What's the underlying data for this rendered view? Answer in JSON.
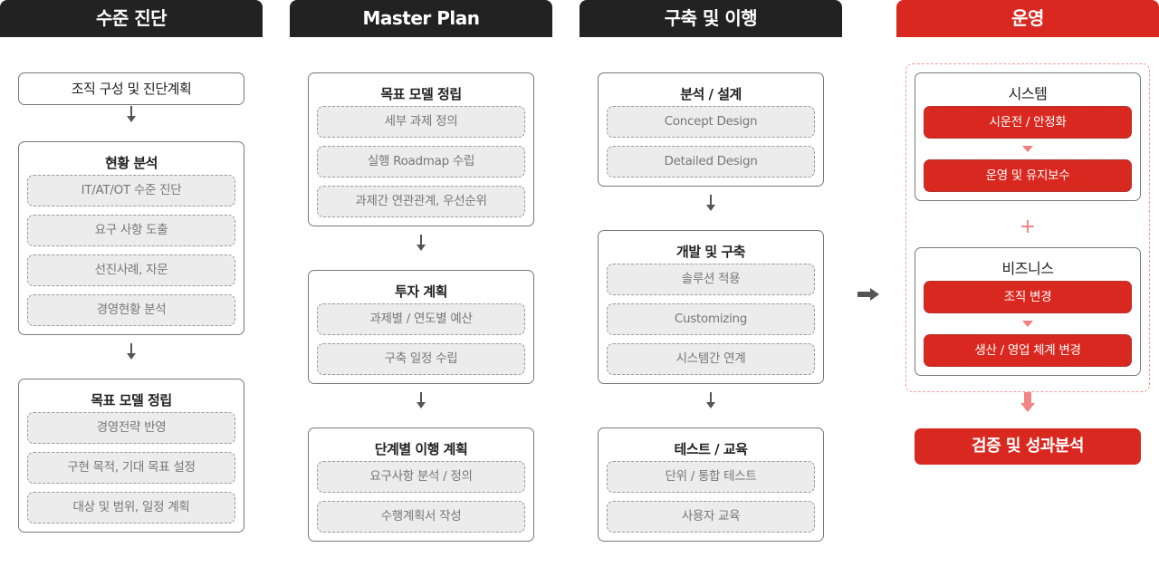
{
  "columns": [
    {
      "title": "수준 진단",
      "boxes": [
        {
          "title": "조직 구성 및 진단계획",
          "items": []
        },
        {
          "title": "현황 분석",
          "items": [
            "IT/AT/OT 수준 진단",
            "요구 사항 도출",
            "선진사례, 자문",
            "경영현황 분석"
          ]
        },
        {
          "title": "목표 모델 정립",
          "items": [
            "경영전략 반영",
            "구현 목적, 기대 목표 설정",
            "대상 및 범위, 일정 계획"
          ]
        }
      ]
    },
    {
      "title": "Master Plan",
      "boxes": [
        {
          "title": "목표 모델 정립",
          "items": [
            "세부 과제 정의",
            "실행 Roadmap 수립",
            "과제간 연관관계, 우선순위"
          ]
        },
        {
          "title": "투자 계획",
          "items": [
            "과제별 / 연도별 예산",
            "구축 일정 수립"
          ]
        },
        {
          "title": "단계별 이행 계획",
          "items": [
            "요구사항 분석 / 정의",
            "수행계획서 작성"
          ]
        }
      ]
    },
    {
      "title": "구축 및 이행",
      "boxes": [
        {
          "title": "분석 / 설계",
          "items": [
            "Concept Design",
            "Detailed Design"
          ]
        },
        {
          "title": "개발 및 구축",
          "items": [
            "솔루션 적용",
            "Customizing",
            "시스템간 연계"
          ]
        },
        {
          "title": "테스트 / 교육",
          "items": [
            "단위 / 통합 테스트",
            "사용자 교육"
          ]
        }
      ]
    },
    {
      "title": "운영",
      "groups": [
        {
          "title": "시스템",
          "steps": [
            "시운전 / 안정화",
            "운영 및 유지보수"
          ]
        },
        {
          "title": "비즈니스",
          "steps": [
            "조직 변경",
            "생산 / 영업 체계 변경"
          ]
        }
      ],
      "plus_symbol": "+",
      "result": "검증 및 성과분석"
    }
  ],
  "icons": {
    "flow_arrow_down": "arrow-down",
    "transition_arrow": "arrow-right",
    "step_triangle": "triangle-down"
  },
  "colors": {
    "dark_header": "#222222",
    "accent_red": "#d9281f",
    "pink_dashed": "#f19a9a",
    "item_bg": "#ececec"
  }
}
